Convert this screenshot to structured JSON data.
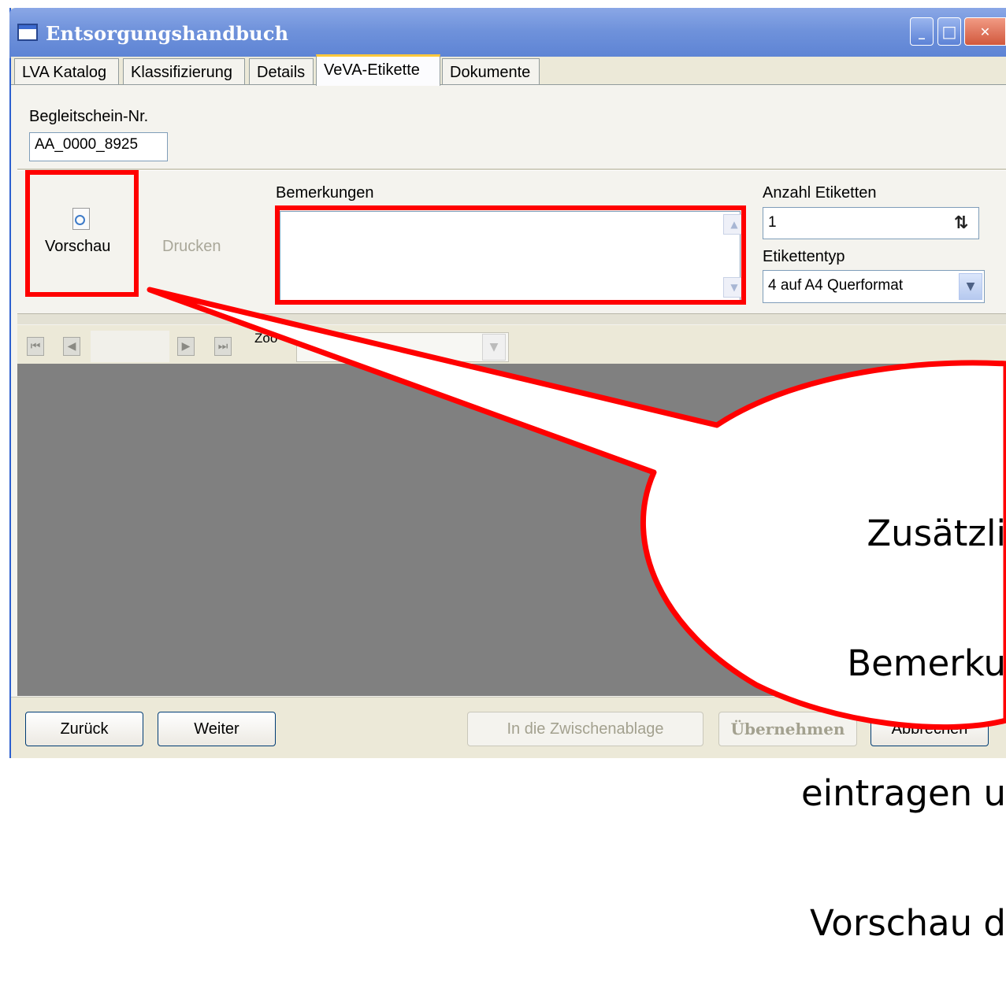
{
  "window": {
    "title": "Entsorgungshandbuch",
    "controls": {
      "minimize": "_",
      "maximize": "□",
      "close": "✕"
    }
  },
  "tabs": [
    {
      "label": "LVA Katalog",
      "active": false
    },
    {
      "label": "Klassifizierung",
      "active": false
    },
    {
      "label": "Details",
      "active": false
    },
    {
      "label": "VeVA-Etikette",
      "active": true
    },
    {
      "label": "Dokumente",
      "active": false
    }
  ],
  "form": {
    "begleitschein_label": "Begleitschein-Nr.",
    "begleitschein_value": "AA_0000_8925",
    "vorschau_label": "Vorschau",
    "drucken_label": "Drucken",
    "bemerkungen_label": "Bemerkungen",
    "bemerkungen_value": "",
    "anzahl_label": "Anzahl Etiketten",
    "anzahl_value": "1",
    "etikettentyp_label": "Etikettentyp",
    "etikettentyp_value": "4 auf A4 Querformat"
  },
  "viewer_toolbar": {
    "zoom_label": "Zoo"
  },
  "buttons": {
    "zurueck": "Zurück",
    "weiter": "Weiter",
    "zwischenablage": "In die Zwischenablage",
    "uebernehmen": "Übernehmen",
    "abbrechen": "Abbrechen"
  },
  "callout": {
    "lines": [
      "Zusätzli",
      "Bemerku",
      "eintragen u",
      "Vorschau d"
    ]
  },
  "colors": {
    "highlight": "#ff0000",
    "titlebar": "#6f92db",
    "viewer": "#808080"
  },
  "icons": {
    "window": "window-icon",
    "preview": "magnifier-page-icon",
    "spin": "spin-arrows-icon",
    "dropdown": "chevron-down-icon",
    "nav": [
      "first-page-icon",
      "prev-page-icon",
      "next-page-icon",
      "last-page-icon"
    ]
  }
}
